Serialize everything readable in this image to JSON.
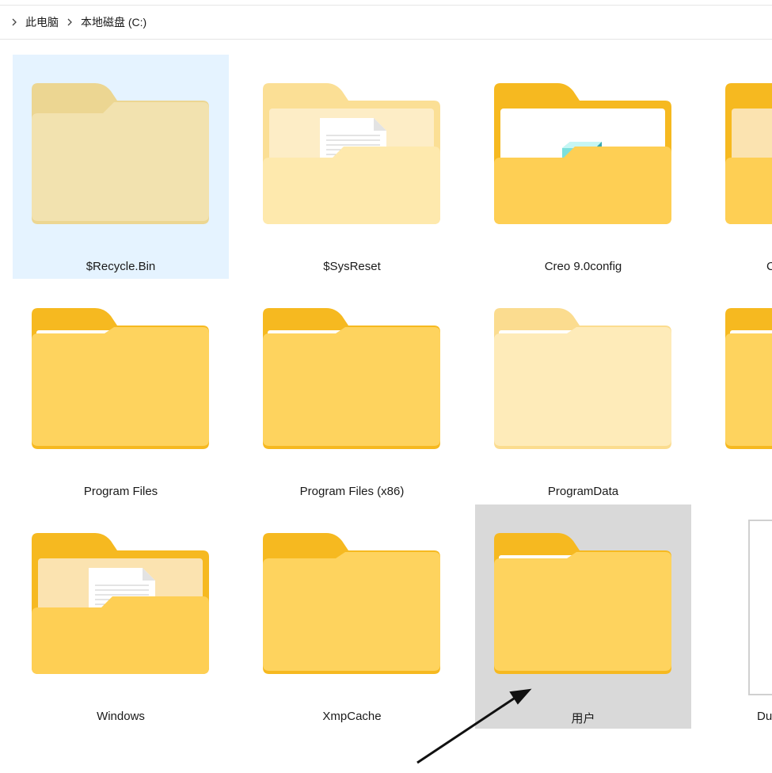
{
  "breadcrumb": {
    "items": [
      "此电脑",
      "本地磁盘 (C:)"
    ]
  },
  "folders": [
    {
      "name": "$Recycle.Bin",
      "state": "selected",
      "style": "pale"
    },
    {
      "name": "$SysReset",
      "state": "normal",
      "style": "pale-doc"
    },
    {
      "name": "Creo 9.0config",
      "state": "normal",
      "style": "content-box"
    },
    {
      "name": "Program Files",
      "state": "normal",
      "style": "paper"
    },
    {
      "name": "Program Files (x86)",
      "state": "normal",
      "style": "paper"
    },
    {
      "name": "ProgramData",
      "state": "normal",
      "style": "pale-paper"
    },
    {
      "name": "Windows",
      "state": "normal",
      "style": "doc"
    },
    {
      "name": "XmpCache",
      "state": "normal",
      "style": "plain"
    },
    {
      "name": "用户",
      "state": "hover",
      "style": "paper"
    }
  ],
  "partial_column": {
    "row3_label": "Du"
  },
  "colors": {
    "folder_back": "#f7c03b",
    "folder_front": "#ffd86b",
    "selected_bg": "#e5f3ff",
    "hover_bg": "#d9d9d9"
  }
}
